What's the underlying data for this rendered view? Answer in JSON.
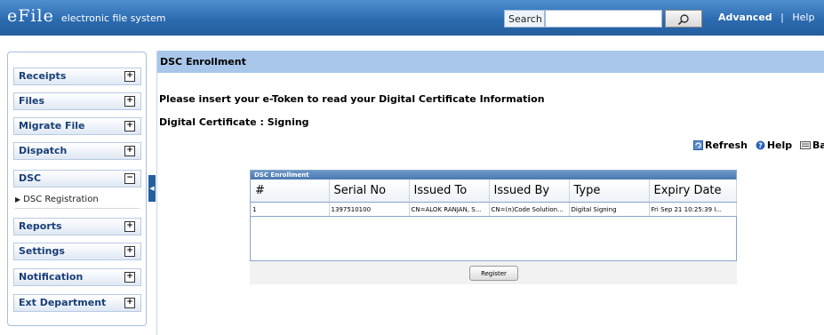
{
  "header": {
    "logo_main": "eFile",
    "logo_sub": "electronic file system",
    "search_label": "Search",
    "search_value": "",
    "advanced_label": "Advanced",
    "separator": "|",
    "help_label": "Help",
    "brand_color": "#2c6bb0"
  },
  "sidebar": {
    "items": [
      {
        "label": "Receipts",
        "state": "+"
      },
      {
        "label": "Files",
        "state": "+"
      },
      {
        "label": "Migrate File",
        "state": "+"
      },
      {
        "label": "Dispatch",
        "state": "+"
      },
      {
        "label": "DSC",
        "state": "−"
      },
      {
        "label": "Reports",
        "state": "+"
      },
      {
        "label": "Settings",
        "state": "+"
      },
      {
        "label": "Notification",
        "state": "+"
      },
      {
        "label": "Ext Department",
        "state": "+"
      }
    ],
    "sub_items": [
      {
        "label": "DSC Registration"
      }
    ]
  },
  "main": {
    "title": "DSC Enrollment",
    "message": "Please insert your e-Token to read your Digital Certificate Information",
    "certificate_label": "Digital Certificate : Signing",
    "toolbar": {
      "refresh": "Refresh",
      "help": "Help",
      "back": "Back"
    },
    "panel": {
      "title": "DSC Enrollment",
      "columns": [
        "#",
        "Serial No",
        "Issued To",
        "Issued By",
        "Type",
        "Expiry Date"
      ],
      "rows": [
        [
          "1",
          "1397510100",
          "CN=ALOK RANJAN, S...",
          "CN=(n)Code Solution...",
          "Digital Signing",
          "Fri Sep 21 10:25:39 I..."
        ]
      ],
      "register_label": "Register"
    }
  },
  "icons": [
    "search-icon",
    "refresh-icon",
    "help-icon",
    "back-icon",
    "collapse-arrow-icon",
    "plus-icon",
    "minus-icon",
    "triangle-right-icon"
  ]
}
